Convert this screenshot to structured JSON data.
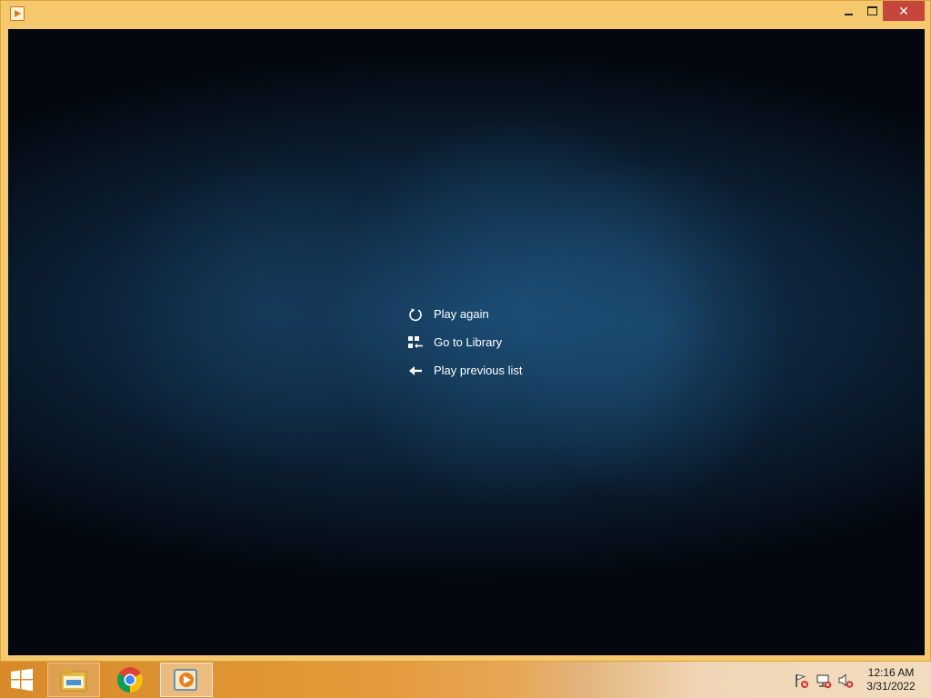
{
  "window": {
    "buttons": {
      "minimize": "",
      "maximize": "",
      "close": "✕"
    }
  },
  "player_menu": {
    "items": [
      {
        "label": "Play again",
        "icon": "replay-icon"
      },
      {
        "label": "Go to Library",
        "icon": "library-icon"
      },
      {
        "label": "Play previous list",
        "icon": "back-arrow-icon"
      }
    ]
  },
  "taskbar": {
    "apps": [
      "File Explorer",
      "Google Chrome",
      "Windows Media Player"
    ],
    "clock": {
      "time": "12:16 AM",
      "date": "3/31/2022"
    }
  },
  "colors": {
    "window_frame": "#f5c86d",
    "close_button": "#c7463b",
    "taskbar": "#e49a3a"
  }
}
